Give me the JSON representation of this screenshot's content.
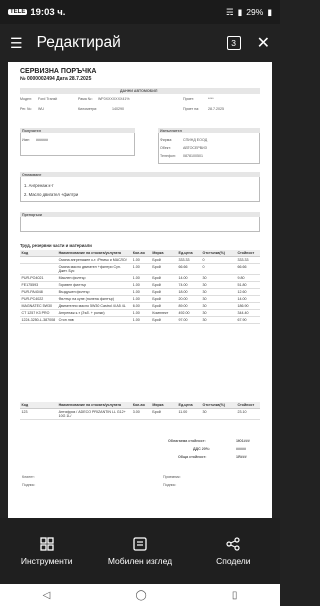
{
  "status": {
    "time": "19:03 ч.",
    "badge": "TELE",
    "battery": "29%"
  },
  "header": {
    "title": "Редактирай",
    "page_count": "3"
  },
  "doc": {
    "title": "СЕРВИЗНА ПОРЪЧКА",
    "number": "№ 0000002494   Дата 28.7.2025",
    "vehicle_header": "ДАННИ АВТОМОБИЛ",
    "vehicle": {
      "model_label": "Модел:",
      "model": "Ford Transit",
      "plate_label": "Рама №:",
      "plate": "WF0XXXXXXX41%",
      "recv_label": "Приет:",
      "recv": "****",
      "reg_label": "Рег. №:",
      "reg": "WU",
      "km_label": "Километри:",
      "km": "140290",
      "recv_date_label": "Приет на:",
      "recv_date": "28.7.2025"
    },
    "client": {
      "title": "Получател",
      "name_label": "Име:",
      "name": "######",
      "cust_title": "Изпълнител",
      "firm_label": "Фирма:",
      "firm": "СПИНД ЕООД",
      "obj_label": "Обект:",
      "obj": "АВТОСЕРВИЗ",
      "phone_label": "Телефон:",
      "phone": "0878100501"
    },
    "issue_title": "Оплакване",
    "issues": [
      "1. Ангренаж к-т",
      "2. Масло двигател +филтри"
    ],
    "rec_title": "Препоръки",
    "parts_title": "Труд, резервни части и материали",
    "parts_headers": [
      "Код",
      "Наименование на стоката/услугата",
      "Кол-во",
      "Мярка",
      "Ед.цена",
      "Отстъпка(%)",
      "Стойност"
    ],
    "parts": [
      [
        "",
        "Смяна ангренажен к-т. /Ремък и МАСЛО/",
        "1.00",
        "Брой",
        "333.33",
        "0",
        "333.33"
      ],
      [
        "",
        "Смяна масло двигател +филтри Суп. Джет. Бус",
        "1.00",
        "Брой",
        "66.66",
        "0",
        "66.66"
      ],
      [
        "PUR-PO4021",
        "Маслен филтър",
        "1.00",
        "Брой",
        "14.00",
        "30",
        "9.80"
      ],
      [
        "FE175593",
        "Горивен филтър",
        "1.00",
        "Брой",
        "74.00",
        "30",
        "51.80"
      ],
      [
        "PUR-PA4048",
        "Въздушен филтър",
        "1.00",
        "Брой",
        "18.00",
        "30",
        "12.60"
      ],
      [
        "PUR-PC4022",
        "Филтър на купе (полена филтър)",
        "1.00",
        "Брой",
        "20.00",
        "30",
        "14.00"
      ],
      [
        "MAGNATEC 5W30",
        "Двигателно масло 5W30 Castrol 4l A5 4L",
        "6.00",
        "Брой",
        "89.00",
        "30",
        "186.90"
      ],
      [
        "CT 1257 K3 PRO",
        "Ангренаж к-т (Зъб. + ролки)",
        "1.00",
        "Комплект",
        "492.00",
        "30",
        "344.40"
      ],
      [
        "1224-3250-L-387008",
        "Стоп ляв",
        "1.00",
        "Брой",
        "97.00",
        "30",
        "67.90"
      ]
    ],
    "parts2_headers": [
      "Код",
      "Наименование на стоката/услугата",
      "Кол-во",
      "Мярка",
      "Ед.цена",
      "Отстъпка(%)",
      "Стойност"
    ],
    "parts2": [
      [
        "123",
        "Антифриз / ADECO PRIZANTIN LL G12+ 10G 1L/",
        "3.00",
        "Брой",
        "11.00",
        "30",
        "23.10"
      ]
    ],
    "totals": [
      {
        "label": "Облагаема стойност:",
        "value": "1Ю1###"
      },
      {
        "label": "ДДС 20%:",
        "value": "#####"
      },
      {
        "label": "Обща стойност:",
        "value": "1Я###"
      }
    ],
    "sign": {
      "left1": "Клиент:",
      "left2": "Подпис:",
      "right1": "Приемник:",
      "right2": "Подпис:"
    }
  },
  "tools": [
    {
      "label": "Инструменти",
      "icon": "grid-icon"
    },
    {
      "label": "Мобилен изглед",
      "icon": "mobile-view-icon"
    },
    {
      "label": "Сподели",
      "icon": "share-icon"
    }
  ]
}
